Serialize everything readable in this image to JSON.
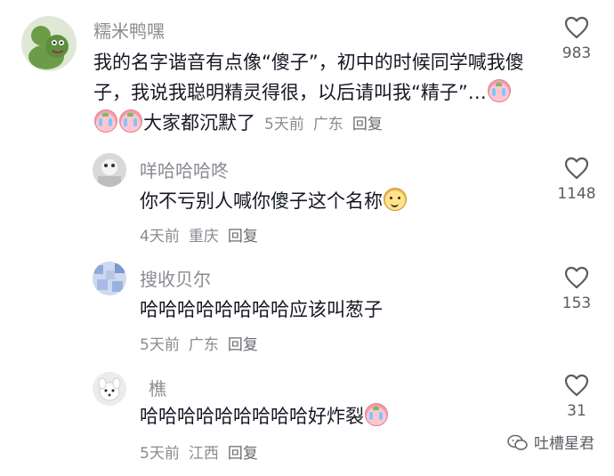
{
  "comments": [
    {
      "username": "糯米鸭嘿",
      "text": "我的名字谐音有点像“傻子”，初中的时候同学喊我傻子，我说我聪明精灵得很，以后请叫我“精子”…",
      "text_after_emoji": "大家都沉默了",
      "time": "5天前",
      "location": "广东",
      "reply": "回复",
      "likes": "983",
      "avatar_icon": "frog-avatar-icon"
    },
    {
      "username": "咩哈哈哈咚",
      "text": "你不亏别人喊你傻子这个名称",
      "time": "4天前",
      "location": "重庆",
      "reply": "回复",
      "likes": "1148",
      "avatar_icon": "photo-avatar-icon"
    },
    {
      "username": "搜收贝尔",
      "text": "哈哈哈哈哈哈哈哈应该叫葱子",
      "time": "5天前",
      "location": "广东",
      "reply": "回复",
      "likes": "153",
      "avatar_icon": "pattern-avatar-icon"
    },
    {
      "username": "樵",
      "text": "哈哈哈哈哈哈哈哈哈好炸裂",
      "time": "5天前",
      "location": "江西",
      "reply": "回复",
      "likes": "31",
      "avatar_icon": "white-dog-avatar-icon"
    }
  ],
  "watermark": {
    "text": "吐槽星君",
    "icon": "wechat-icon"
  },
  "colors": {
    "text": "#161823",
    "secondary": "#8a8b91",
    "frog_green": "#6b9d48"
  }
}
